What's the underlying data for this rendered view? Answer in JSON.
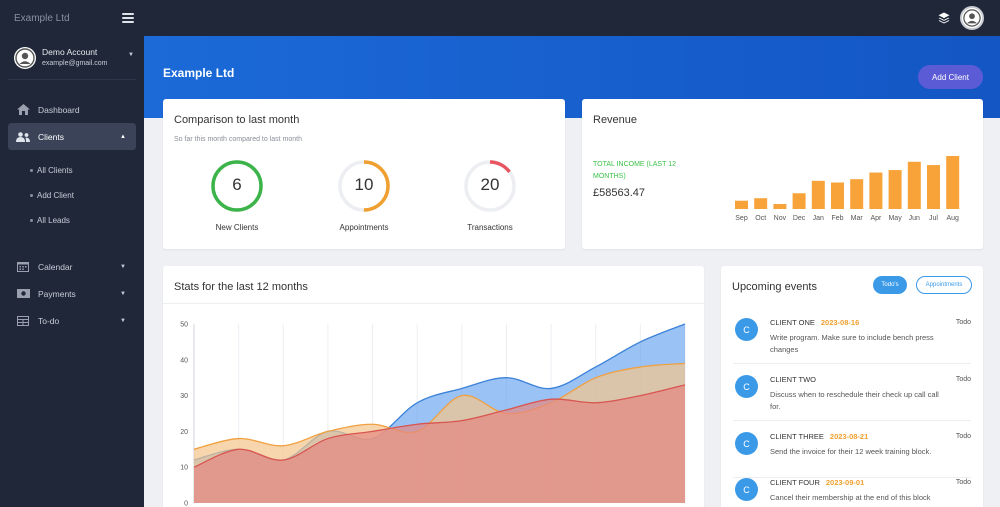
{
  "app": {
    "brand": "Example Ltd"
  },
  "account": {
    "name": "Demo Account",
    "email": "example@gmail.com"
  },
  "nav": {
    "dashboard": "Dashboard",
    "clients": "Clients",
    "clients_sub": [
      "All Clients",
      "Add Client",
      "All Leads"
    ],
    "calendar": "Calendar",
    "payments": "Payments",
    "todo": "To-do"
  },
  "hero": {
    "title": "Example Ltd",
    "add_client": "Add Client"
  },
  "comparison": {
    "title": "Comparison to last month",
    "subtitle": "So far this month compared to last month",
    "gauges": [
      {
        "value": "6",
        "label": "New Clients",
        "percent": 100,
        "color": "#3cb44a"
      },
      {
        "value": "10",
        "label": "Appointments",
        "percent": 50,
        "color": "#f0a030"
      },
      {
        "value": "20",
        "label": "Transactions",
        "percent": 15,
        "color": "#e85560"
      }
    ]
  },
  "revenue": {
    "title": "Revenue",
    "income_label": "TOTAL INCOME (LAST 12 MONTHS)",
    "income_amount": "£58563.47"
  },
  "stats": {
    "title": "Stats for the last 12 months"
  },
  "events": {
    "title": "Upcoming events",
    "btn_todos": "Todo's",
    "btn_appointments": "Appointments",
    "items": [
      {
        "initial": "C",
        "name": "CLIENT ONE",
        "date": "2023-08-16",
        "desc": "Write program. Make sure to include bench press changes",
        "tag": "Todo"
      },
      {
        "initial": "C",
        "name": "CLIENT TWO",
        "date": "",
        "desc": "Discuss when to reschedule their check up call call for.",
        "tag": "Todo"
      },
      {
        "initial": "C",
        "name": "CLIENT THREE",
        "date": "2023-08-21",
        "desc": "Send the invoice for their 12 week training block.",
        "tag": "Todo"
      },
      {
        "initial": "C",
        "name": "CLIENT FOUR",
        "date": "2023-09-01",
        "desc": "Cancel their membership at the end of this block",
        "tag": "Todo"
      }
    ]
  },
  "chart_data": [
    {
      "type": "bar",
      "categories": [
        "Sep",
        "Oct",
        "Nov",
        "Dec",
        "Jan",
        "Feb",
        "Mar",
        "Apr",
        "May",
        "Jun",
        "Jul",
        "Aug"
      ],
      "values": [
        1,
        1.3,
        0.6,
        1.9,
        3.4,
        3.2,
        3.6,
        4.4,
        4.7,
        5.7,
        5.3,
        6.4
      ],
      "ylim": [
        0,
        7
      ],
      "color": "#f7a33a",
      "title": "",
      "xlabel": "",
      "ylabel": ""
    },
    {
      "type": "area",
      "x": [
        0,
        1,
        2,
        3,
        4,
        5,
        6,
        7,
        8,
        9,
        10,
        11
      ],
      "yticks": [
        0,
        10,
        20,
        30,
        40,
        50
      ],
      "ylim": [
        0,
        50
      ],
      "grid": true,
      "series": [
        {
          "values": [
            12,
            15,
            12,
            20,
            18,
            28,
            32,
            35,
            32,
            38,
            45,
            50
          ],
          "color": "#6fa8f0",
          "stroke": "#3b82d8"
        },
        {
          "values": [
            15,
            18,
            16,
            20,
            22,
            20,
            30,
            25,
            28,
            35,
            38,
            39
          ],
          "color": "#f5c48a",
          "stroke": "#f0a040"
        },
        {
          "values": [
            10,
            15,
            12,
            18,
            20,
            22,
            23,
            26,
            29,
            28,
            30,
            33
          ],
          "color": "#e58880",
          "stroke": "#d85550"
        }
      ],
      "title": "",
      "xlabel": "",
      "ylabel": ""
    }
  ]
}
